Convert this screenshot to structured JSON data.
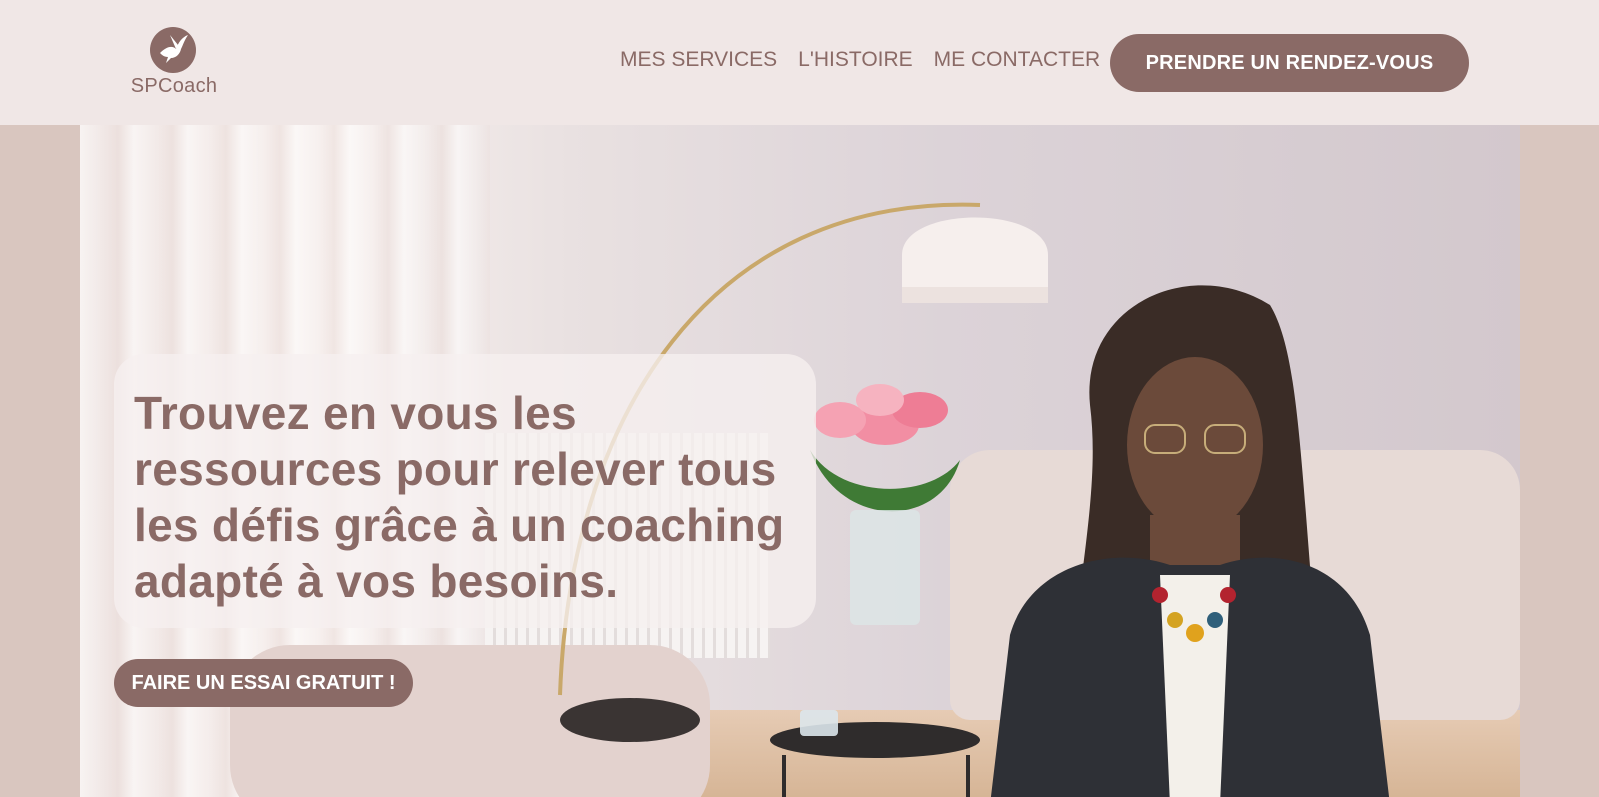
{
  "brand": {
    "name": "SPCoach",
    "logo_icon": "hummingbird-icon"
  },
  "nav": {
    "items": [
      {
        "label": "MES SERVICES"
      },
      {
        "label": "L'HISTOIRE"
      },
      {
        "label": "ME CONTACTER"
      }
    ],
    "cta_label": "PRENDRE UN RENDEZ-VOUS"
  },
  "hero": {
    "headline_part1": "Trouvez en vous les ressources pour relever tous les défis grâce à un ",
    "headline_bold1": "coaching adapté",
    "headline_part2": " à ",
    "headline_bold2": "vos besoins",
    "headline_part3": ".",
    "cta_label": "FAIRE UN ESSAI GRATUIT !"
  },
  "colors": {
    "accent": "#8a6a66",
    "header_bg": "#f0e7e6",
    "side_bg": "#d9c6bf"
  }
}
